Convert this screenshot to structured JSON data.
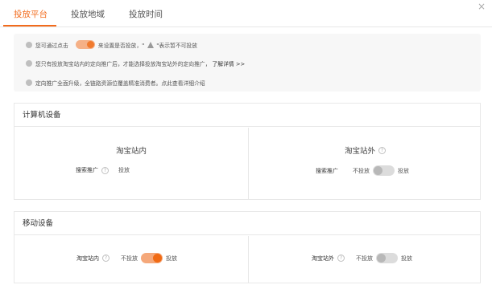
{
  "tabs": [
    {
      "label": "投放平台",
      "active": true
    },
    {
      "label": "投放地域",
      "active": false
    },
    {
      "label": "投放时间",
      "active": false
    }
  ],
  "close_icon": "×",
  "notice": {
    "line1_before": "您可通过点击",
    "line1_after": "来设置是否投放，\"",
    "line1_end": "\"表示暂不可投放",
    "line2_text": "您只有投放淘宝站内的定向推广后，才能选择投放淘宝站外的定向推广，",
    "line2_link": "了解详情 >>",
    "line3_text": "定向推广全面升级，全链路资源位覆盖精准消费者。点此查看详细介绍"
  },
  "computer": {
    "title": "计算机设备",
    "inside": {
      "title": "淘宝站内",
      "row_label": "搜索推广",
      "value": "投放"
    },
    "outside": {
      "title": "淘宝站外",
      "row_label": "搜索推广",
      "off_label": "不投放",
      "on_label": "投放"
    }
  },
  "mobile": {
    "title": "移动设备",
    "inside": {
      "row_label": "淘宝站内",
      "off_label": "不投放",
      "on_label": "投放"
    },
    "outside": {
      "row_label": "淘宝站外",
      "off_label": "不投放",
      "on_label": "投放"
    }
  },
  "colors": {
    "accent": "#f26b1c",
    "toggle_on": "#f06a14",
    "toggle_off": "#b8b8b8"
  }
}
